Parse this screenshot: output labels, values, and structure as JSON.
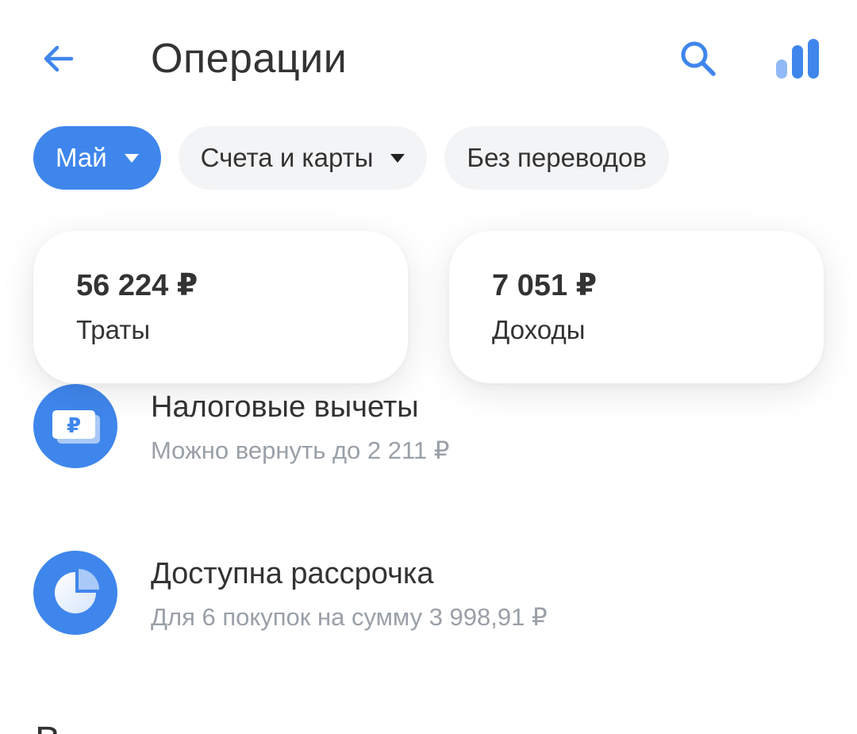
{
  "header": {
    "title": "Операции",
    "back_icon": "arrow-left-icon",
    "search_icon": "search-icon",
    "analytics_icon": "bar-chart-icon"
  },
  "filters": {
    "month_label": "Май",
    "accounts_label": "Счета и карты",
    "transfers_label": "Без переводов"
  },
  "summary": {
    "spend_amount": "56 224 ₽",
    "spend_label": "Траты",
    "income_amount": "7 051 ₽",
    "income_label": "Доходы"
  },
  "offers": [
    {
      "title": "Налоговые вычеты",
      "subtitle": "Можно вернуть до 2 211 ₽",
      "icon": "ruble-card-icon"
    },
    {
      "title": "Доступна рассрочка",
      "subtitle": "Для 6 покупок на сумму 3 998,91 ₽",
      "icon": "pie-chart-icon"
    }
  ],
  "next_section_partial": "В",
  "colors": {
    "accent": "#3f86ec",
    "chip_bg": "#f3f4f6",
    "text_primary": "#333333",
    "text_secondary": "#9aa0a8"
  }
}
